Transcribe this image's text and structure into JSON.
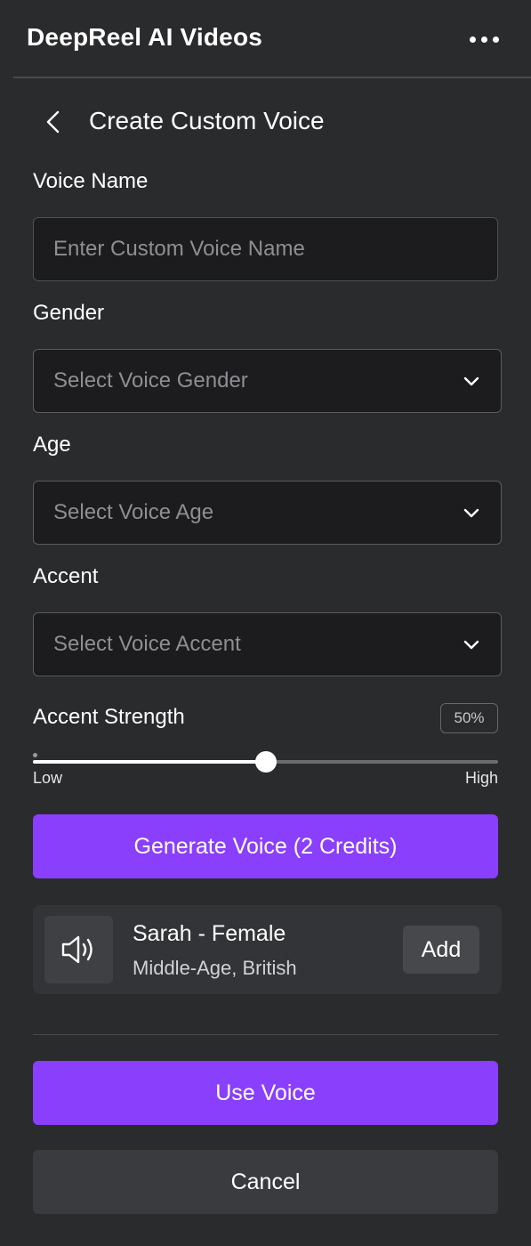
{
  "header": {
    "app_title": "DeepReel AI Videos",
    "more_icon": "more-horizontal-icon"
  },
  "page": {
    "back_icon": "chevron-left-icon",
    "title": "Create Custom Voice"
  },
  "form": {
    "voice_name": {
      "label": "Voice Name",
      "value": "",
      "placeholder": "Enter Custom Voice Name"
    },
    "gender": {
      "label": "Gender",
      "placeholder": "Select Voice Gender"
    },
    "age": {
      "label": "Age",
      "placeholder": "Select Voice Age"
    },
    "accent": {
      "label": "Accent",
      "placeholder": "Select Voice Accent"
    },
    "accent_strength": {
      "label": "Accent Strength",
      "value_text": "50%",
      "value": 0.5,
      "min_label": "Low",
      "max_label": "High"
    },
    "generate_button": "Generate Voice (2 Credits)"
  },
  "voice_result": {
    "icon": "speaker-icon",
    "name": "Sarah - Female",
    "meta": "Middle-Age, British",
    "add_label": "Add"
  },
  "actions": {
    "use_voice": "Use Voice",
    "cancel": "Cancel"
  },
  "colors": {
    "background": "#2a2b2d",
    "accent": "#8a3ffc",
    "input_bg": "#1c1c1e"
  }
}
